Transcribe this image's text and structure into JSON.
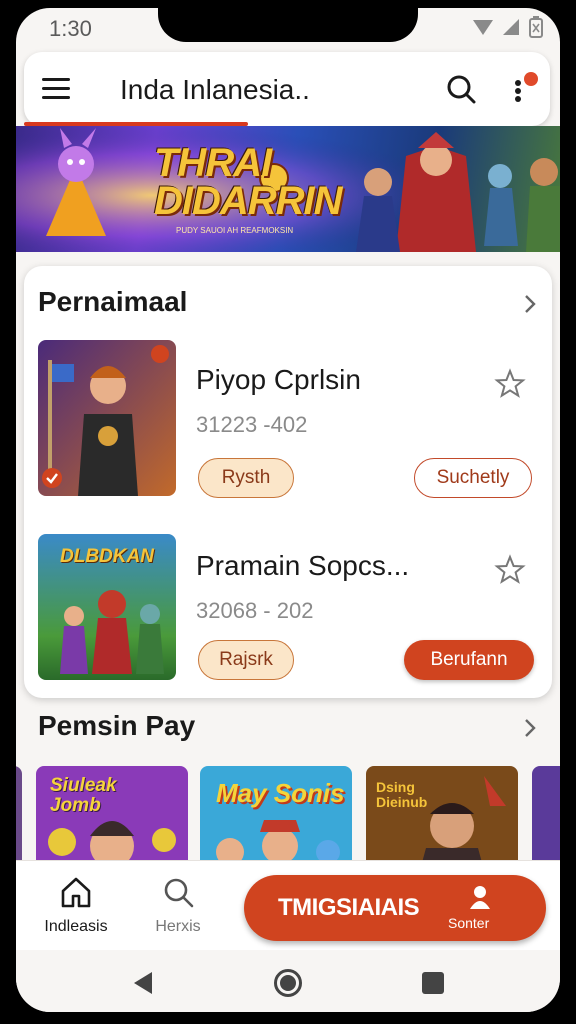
{
  "status": {
    "time": "1:30"
  },
  "appbar": {
    "title": "Inda Inlanesia.."
  },
  "banner": {
    "title_line1": "THRAI",
    "title_line2": "DIDARRIN",
    "subtitle": "PUDY SAUOI AH REAFMOKSIN"
  },
  "section1": {
    "title": "Pernaimaal",
    "items": [
      {
        "name": "Piyop Cprlsin",
        "meta": "31223 -402",
        "left_button": "Rysth",
        "right_button": "Suchetly",
        "thumb_text": ""
      },
      {
        "name": "Pramain Sopcs...",
        "meta": "32068 - 202",
        "left_button": "Rajsrk",
        "right_button": "Berufann",
        "thumb_text": "DLBDKAN"
      }
    ]
  },
  "section2": {
    "title": "Pemsin Pay",
    "thumbs": [
      {
        "text": "Siuleak Jomb"
      },
      {
        "text": "May Sonis"
      },
      {
        "text": "Dsing Dieinub"
      },
      {
        "text": ""
      }
    ]
  },
  "bottomnav": {
    "home_label": "Indleasis",
    "search_label": "Herxis",
    "cta_label": "TMIGSIAIAIS",
    "cta_sub_label": "Sonter"
  },
  "colors": {
    "accent": "#d0441f",
    "soft": "#fbe6c9"
  }
}
